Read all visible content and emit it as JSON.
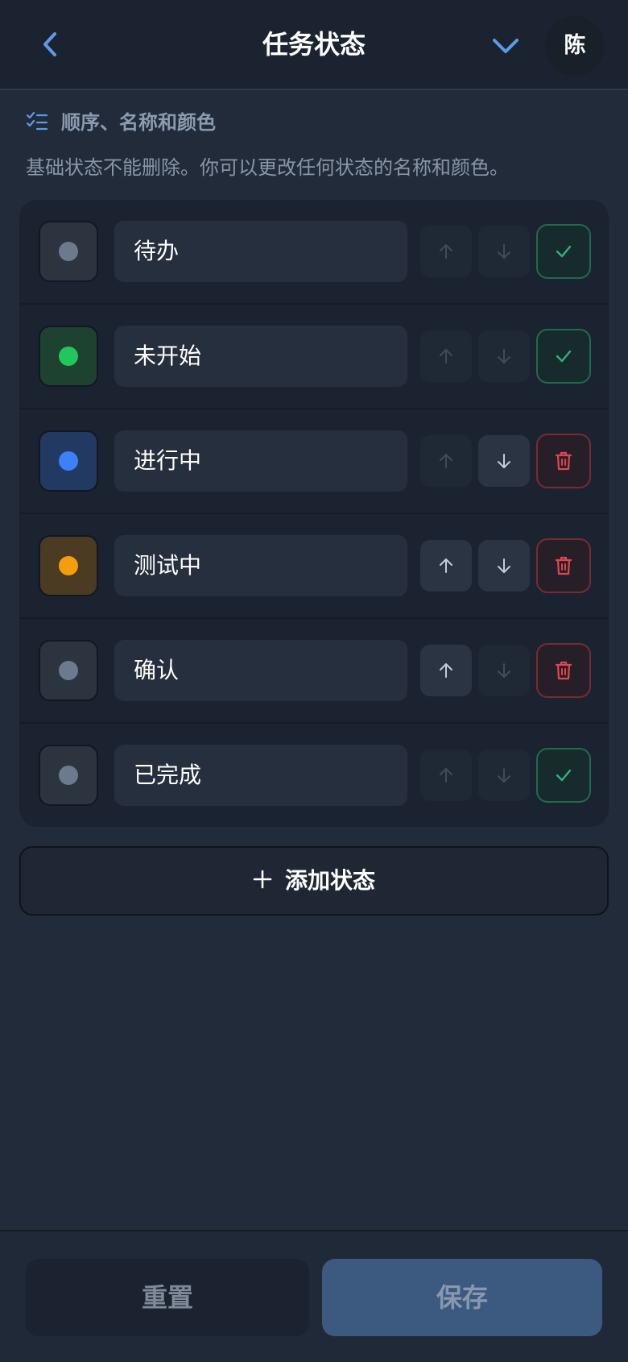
{
  "header": {
    "title": "任务状态",
    "avatar_initial": "陈",
    "back_icon": "chevron-left-icon",
    "menu_icon": "chevron-down-icon"
  },
  "section": {
    "icon": "checklist-icon",
    "title": "顺序、名称和颜色",
    "description": "基础状态不能删除。你可以更改任何状态的名称和颜色。"
  },
  "colors": {
    "accent": "#5b9be6",
    "check": "#2db381",
    "delete": "#e0464f"
  },
  "statuses": [
    {
      "name": "待办",
      "color": "#6b7a8d",
      "swatch_bg": "#2c3440",
      "up_enabled": false,
      "down_enabled": false,
      "action": "check"
    },
    {
      "name": "未开始",
      "color": "#22c55e",
      "swatch_bg": "#1e4230",
      "up_enabled": false,
      "down_enabled": false,
      "action": "check"
    },
    {
      "name": "进行中",
      "color": "#3b82f6",
      "swatch_bg": "#223a62",
      "up_enabled": false,
      "down_enabled": true,
      "action": "delete"
    },
    {
      "name": "测试中",
      "color": "#f59e0b",
      "swatch_bg": "#4a3b22",
      "up_enabled": true,
      "down_enabled": true,
      "action": "delete"
    },
    {
      "name": "确认",
      "color": "#6b7a8d",
      "swatch_bg": "#2c3440",
      "up_enabled": true,
      "down_enabled": false,
      "action": "delete"
    },
    {
      "name": "已完成",
      "color": "#6b7a8d",
      "swatch_bg": "#2c3440",
      "up_enabled": false,
      "down_enabled": false,
      "action": "check"
    }
  ],
  "add_button": {
    "label": "添加状态",
    "icon": "plus-icon"
  },
  "footer": {
    "reset_label": "重置",
    "save_label": "保存"
  }
}
